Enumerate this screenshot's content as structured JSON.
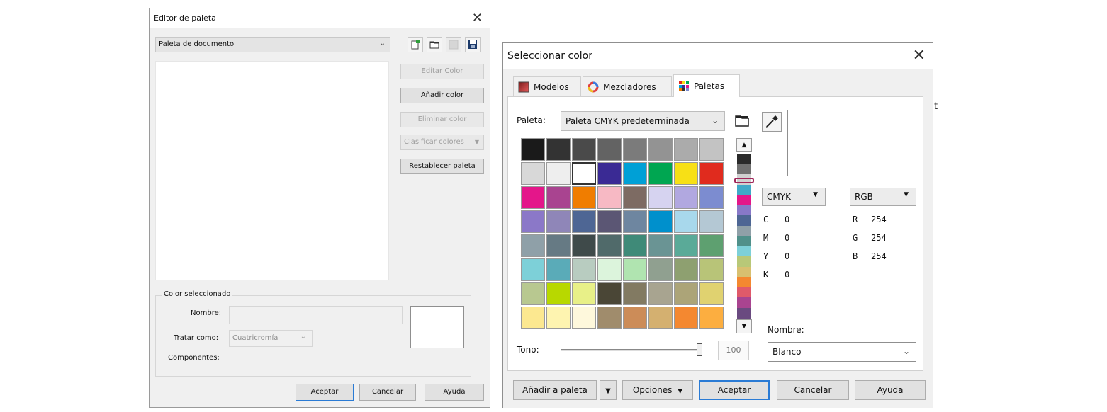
{
  "editor": {
    "title": "Editor de paleta",
    "close_glyph": "✕",
    "palette_select": "Paleta de documento",
    "buttons": {
      "edit_color": "Editar Color",
      "add_color": "Añadir color",
      "delete_color": "Eliminar color",
      "sort_colors": "Clasificar colores",
      "reset_palette": "Restablecer paleta"
    },
    "selected_group": {
      "legend": "Color seleccionado",
      "name_label": "Nombre:",
      "name_value": "",
      "treat_as_label": "Tratar como:",
      "treat_as_value": "Cuatricromía",
      "components_label": "Componentes:"
    },
    "footer": {
      "accept": "Aceptar",
      "cancel": "Cancelar",
      "help": "Ayuda"
    }
  },
  "picker": {
    "title": "Seleccionar color",
    "close_glyph": "✕",
    "tabs": [
      {
        "label": "Modelos",
        "icon": "models-icon",
        "active": false
      },
      {
        "label": "Mezcladores",
        "icon": "mixers-icon",
        "active": false
      },
      {
        "label": "Paletas",
        "icon": "palettes-icon",
        "active": true
      }
    ],
    "palette_label": "Paleta:",
    "palette_value": "Paleta CMYK predeterminada",
    "swatches": [
      [
        "#1a1a1a",
        "#333333",
        "#4a4a4a",
        "#636363",
        "#7b7b7b",
        "#939393",
        "#ababab",
        "#c3c3c3"
      ],
      [
        "#d8d8d8",
        "#eeeeee",
        "#ffffff",
        "#3a2a94",
        "#00a0d6",
        "#00a651",
        "#f7e016",
        "#e02b1e"
      ],
      [
        "#e4168a",
        "#a94490",
        "#f07d00",
        "#f7b9c4",
        "#7d6b63",
        "#d6d3f0",
        "#b1a8e0",
        "#7c8cd0"
      ],
      [
        "#8b78c8",
        "#8f86b8",
        "#4e6694",
        "#5b5674",
        "#6e86a0",
        "#0090cc",
        "#a8d8ec",
        "#b4c8d4"
      ],
      [
        "#8fa0a8",
        "#667a84",
        "#3f4a4a",
        "#506a6a",
        "#3f8a78",
        "#6a9494",
        "#5aaa98",
        "#5ea070"
      ],
      [
        "#7dd0d8",
        "#5aabb8",
        "#b8ccc0",
        "#dcf4dc",
        "#b0e4b0",
        "#90a090",
        "#8ea070",
        "#b8c478"
      ],
      [
        "#b8c890",
        "#b8d800",
        "#e8f088",
        "#4a4636",
        "#827a62",
        "#a8a490",
        "#aca478",
        "#e0d270"
      ],
      [
        "#fce890",
        "#fef4b0",
        "#fef8dc",
        "#a08c6c",
        "#cc8c58",
        "#d4b070",
        "#f48830",
        "#fcae40"
      ]
    ],
    "selected_swatch_color": "#ffffff",
    "color_strip": [
      "#2a2a2a",
      "#707070",
      "#d0d0d0",
      "#3fa9c8",
      "#e4168a",
      "#8878c8",
      "#4e6694",
      "#90a0a8",
      "#50908a",
      "#7dd0d8",
      "#b8c878",
      "#d8c070",
      "#f48830",
      "#e05a6a",
      "#a94490",
      "#6a4a80"
    ],
    "color_models": {
      "left": "CMYK",
      "right": "RGB"
    },
    "cmyk": [
      {
        "k": "C",
        "v": "0"
      },
      {
        "k": "M",
        "v": "0"
      },
      {
        "k": "Y",
        "v": "0"
      },
      {
        "k": "K",
        "v": "0"
      }
    ],
    "rgb": [
      {
        "k": "R",
        "v": "254"
      },
      {
        "k": "G",
        "v": "254"
      },
      {
        "k": "B",
        "v": "254"
      }
    ],
    "tone_label": "Tono:",
    "tone_value": "100",
    "tone_level": 1.0,
    "name_label": "Nombre:",
    "name_value": "Blanco",
    "footer": {
      "add_to_palette": "Añadir a paleta",
      "options": "Opciones",
      "accept": "Aceptar",
      "cancel": "Cancelar",
      "help": "Ayuda"
    }
  },
  "edge_letter": "t"
}
